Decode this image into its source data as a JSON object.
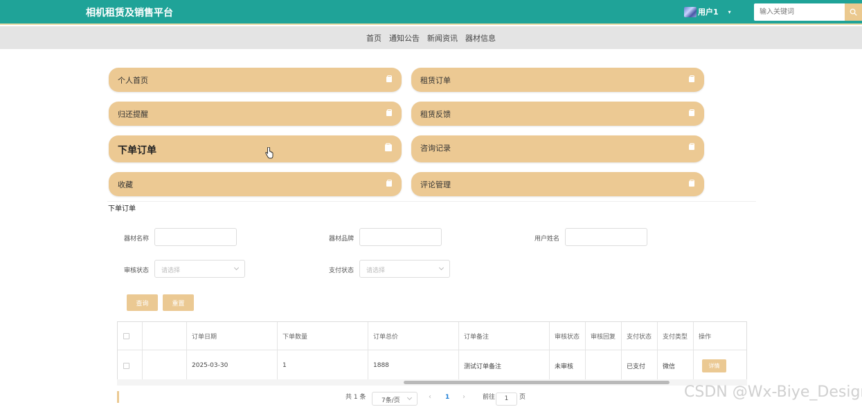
{
  "header": {
    "brand": "相机租赁及销售平台",
    "user_name": "用户1",
    "caret": "▾",
    "search_placeholder": "输入关键词"
  },
  "nav": {
    "items": [
      "首页",
      "通知公告",
      "新闻资讯",
      "器材信息"
    ]
  },
  "menu": {
    "items": [
      {
        "label": "个人首页"
      },
      {
        "label": "租赁订单"
      },
      {
        "label": "归还提醒"
      },
      {
        "label": "租赁反馈"
      },
      {
        "label": "下单订单",
        "active": true
      },
      {
        "label": "咨询记录"
      },
      {
        "label": "收藏"
      },
      {
        "label": "评论管理"
      }
    ]
  },
  "section_title": "下单订单",
  "filters": {
    "name_label": "器材名称",
    "brand_label": "器材品牌",
    "user_label": "用户姓名",
    "audit_label": "审核状态",
    "audit_placeholder": "请选择",
    "pay_label": "支付状态",
    "pay_placeholder": "请选择",
    "query_button": "查询",
    "reset_button": "重置"
  },
  "table": {
    "columns": [
      "",
      "",
      "订单日期",
      "下单数量",
      "订单总价",
      "订单备注",
      "审核状态",
      "审核回复",
      "支付状态",
      "支付类型",
      "操作"
    ],
    "rows": [
      {
        "date": "2025-03-30",
        "qty": "1",
        "total": "1888",
        "note": "测试订单备注",
        "audit_status": "未审核",
        "audit_reply": "",
        "pay_status": "已支付",
        "pay_type": "微信",
        "action": "详情"
      }
    ]
  },
  "pagination": {
    "total": "共 1 条",
    "page_size": "7条/页",
    "current_page": "1",
    "goto_label": "前往",
    "goto_value": "1",
    "page_unit": "页",
    "prev": "‹",
    "next": "›"
  },
  "watermark": "CSDN @Wx-Biye_Design",
  "colors": {
    "topbar": "#1fa398",
    "accent": "#ecc993",
    "navbar": "#e4e4e4"
  }
}
